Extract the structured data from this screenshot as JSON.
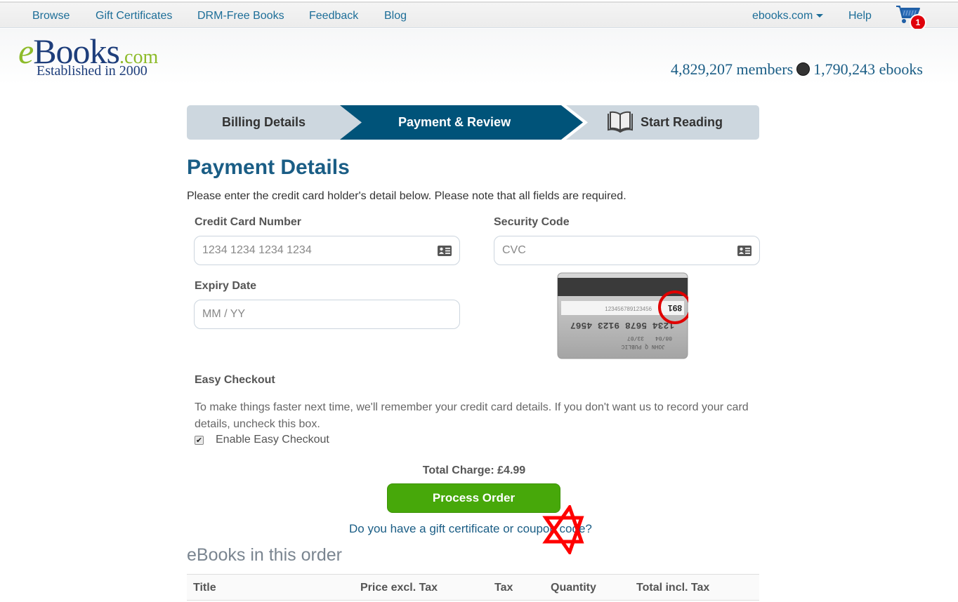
{
  "topnav": {
    "links": [
      "Browse",
      "Gift Certificates",
      "DRM-Free Books",
      "Feedback",
      "Blog"
    ],
    "site_selector": "ebooks.com",
    "help": "Help",
    "cart_count": "1",
    "link_color": "#1d6e98"
  },
  "header": {
    "logo_e": "e",
    "logo_books": "Books",
    "logo_com": ".com",
    "logo_tagline": "Established in 2000",
    "members": "4,829,207 members",
    "ebooks": "1,790,243 ebooks"
  },
  "steps": [
    {
      "label": "Billing Details",
      "active": false
    },
    {
      "label": "Payment & Review",
      "active": true
    },
    {
      "label": "Start Reading",
      "active": false,
      "icon": "book-open-icon"
    }
  ],
  "payment": {
    "title": "Payment Details",
    "intro": "Please enter the credit card holder's detail below. Please note that all fields are required.",
    "card_number": {
      "label": "Credit Card Number",
      "placeholder": "1234 1234 1234 1234",
      "value": ""
    },
    "security_code": {
      "label": "Security Code",
      "placeholder": "CVC",
      "value": ""
    },
    "expiry": {
      "label": "Expiry Date",
      "placeholder": "MM / YY",
      "value": ""
    },
    "cvc_image": {
      "card_number": "1234 5678 9123 4567",
      "signature_digits": "123456789123456",
      "cvc": "891",
      "expiry": "08/04",
      "valid": "33/07",
      "name": "JOHN Q PUBLIC"
    }
  },
  "easy_checkout": {
    "title": "Easy Checkout",
    "text": "To make things faster next time, we'll remember your credit card details. If you don't want us to record your card details, uncheck this box.",
    "checkbox_label": "Enable Easy Checkout",
    "checked": true
  },
  "order": {
    "total_label": "Total Charge: £4.99",
    "process_button": "Process Order",
    "coupon_link": "Do you have a gift certificate or coupon code?",
    "section_title": "eBooks in this order",
    "columns": [
      "Title",
      "Price excl. Tax",
      "Tax",
      "Quantity",
      "Total incl. Tax"
    ],
    "button_color": "#47a80a"
  }
}
